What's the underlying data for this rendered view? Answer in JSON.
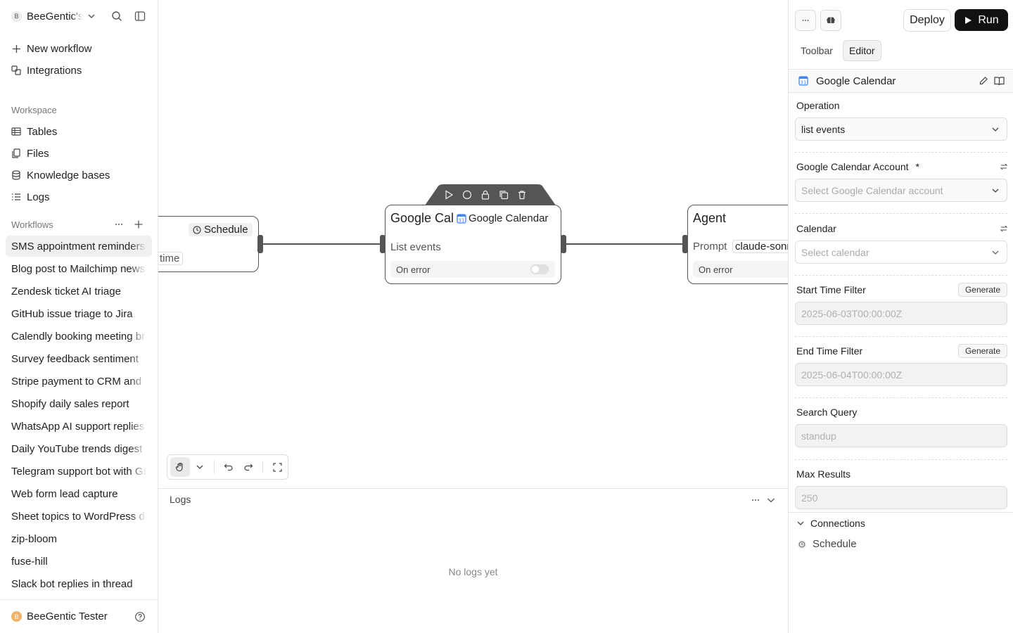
{
  "sidebar": {
    "workspace_initial": "B",
    "workspace_name": "BeeGentic's",
    "nav": [
      {
        "label": "New workflow",
        "icon": "plus-icon"
      },
      {
        "label": "Integrations",
        "icon": "puzzle-icon"
      }
    ],
    "workspace_section": {
      "label": "Workspace",
      "items": [
        {
          "label": "Tables",
          "icon": "table-icon"
        },
        {
          "label": "Files",
          "icon": "files-icon"
        },
        {
          "label": "Knowledge bases",
          "icon": "database-icon"
        },
        {
          "label": "Logs",
          "icon": "list-icon"
        }
      ]
    },
    "workflows_section": {
      "label": "Workflows",
      "items": [
        "SMS appointment reminders",
        "Blog post to Mailchimp newsletter",
        "Zendesk ticket AI triage",
        "GitHub issue triage to Jira",
        "Calendly booking meeting brief",
        "Survey feedback sentiment",
        "Stripe payment to CRM and",
        "Shopify daily sales report",
        "WhatsApp AI support replies",
        "Daily YouTube trends digest",
        "Telegram support bot with GPT",
        "Web form lead capture",
        "Sheet topics to WordPress drafts",
        "zip-bloom",
        "fuse-hill",
        "Slack bot replies in thread"
      ],
      "active_index": 0
    },
    "user": {
      "initial": "B",
      "name": "BeeGentic Tester"
    }
  },
  "canvas": {
    "schedule_node": {
      "badge": "Schedule",
      "field": "time"
    },
    "calendar_node": {
      "title": "Google Calendar",
      "badge": "Google Calendar",
      "field": "List events",
      "on_error": "On error"
    },
    "agent_node": {
      "title": "Agent",
      "field_label": "Prompt",
      "model": "claude-sonnet",
      "on_error": "On error"
    }
  },
  "logs": {
    "title": "Logs",
    "empty_text": "No logs yet"
  },
  "panel": {
    "deploy_label": "Deploy",
    "run_label": "Run",
    "tabs": [
      "Toolbar",
      "Editor"
    ],
    "active_tab": 1,
    "block_title": "Google Calendar",
    "fields": {
      "operation": {
        "label": "Operation",
        "value": "list events"
      },
      "account": {
        "label": "Google Calendar Account",
        "required": "*",
        "placeholder": "Select Google Calendar account"
      },
      "calendar": {
        "label": "Calendar",
        "placeholder": "Select calendar"
      },
      "start_time": {
        "label": "Start Time Filter",
        "placeholder": "2025-06-03T00:00:00Z",
        "action": "Generate"
      },
      "end_time": {
        "label": "End Time Filter",
        "placeholder": "2025-06-04T00:00:00Z",
        "action": "Generate"
      },
      "search_query": {
        "label": "Search Query",
        "placeholder": "standup"
      },
      "max_results": {
        "label": "Max Results",
        "placeholder": "250"
      }
    },
    "connections": {
      "label": "Connections",
      "items": [
        "Schedule"
      ]
    }
  }
}
